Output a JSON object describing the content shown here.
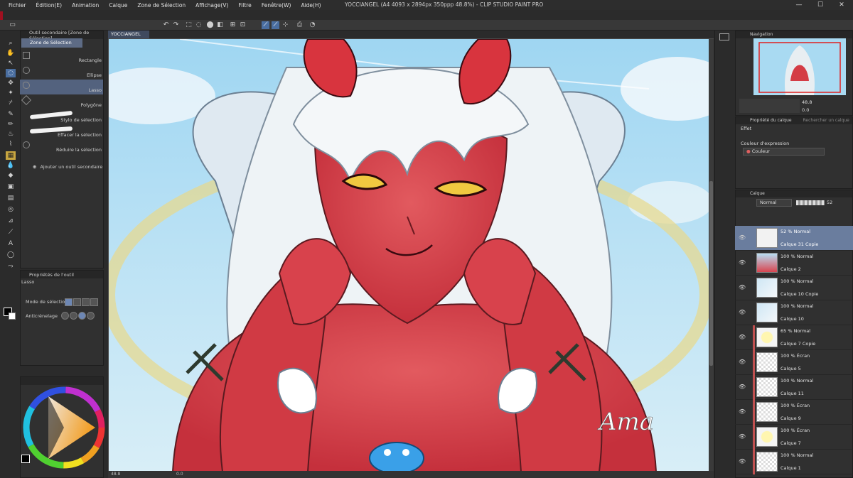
{
  "window": {
    "title": "YOCCIANGEL (A4 4093 x 2894px 350ppp 48.8%) - CLIP STUDIO PAINT PRO",
    "minimize": "—",
    "maximize": "☐",
    "close": "✕"
  },
  "menu": [
    "Fichier",
    "Édition(E)",
    "Animation",
    "Calque",
    "Zone de Sélection",
    "Affichage(V)",
    "Filtre",
    "Fenêtre(W)",
    "Aide(H)"
  ],
  "subtool": {
    "header": "Outil secondaire [Zone de Sélection]",
    "tab": "Zone de Sélection",
    "items": [
      {
        "label": "Rectangle",
        "selected": false
      },
      {
        "label": "Ellipse",
        "selected": false
      },
      {
        "label": "Lasso",
        "selected": true
      },
      {
        "label": "Polygône",
        "selected": false
      },
      {
        "label": "Stylo de sélection",
        "selected": false
      },
      {
        "label": "Effacer la sélection",
        "selected": false
      },
      {
        "label": "Réduire la sélection",
        "selected": false
      }
    ],
    "add": "Ajouter un outil secondaire"
  },
  "toolprops": {
    "header": "Propriétés de l'outil",
    "tool_name": "Lasso",
    "mode_label": "Mode de sélection",
    "aa_label": "Anticrénelage"
  },
  "canvas": {
    "tab": "YOCCIANGEL",
    "zoom": "48.8",
    "rotation": "0.0",
    "signature": "Ama"
  },
  "navigator": {
    "header": "Navigation",
    "zoom": "48.8",
    "angle": "0.0"
  },
  "layerprops": {
    "header": "Propriété du calque",
    "search": "Rechercher un calque",
    "effect": "Effet",
    "expr_color_label": "Couleur d'expression",
    "expr_color_value": "Couleur"
  },
  "layers_panel": {
    "header": "Calque",
    "blend": "Normal",
    "opacity": "52"
  },
  "layers": [
    {
      "mode": "52 % Normal",
      "name": "Calque 31 Copie",
      "selected": true,
      "thumb": "sketch"
    },
    {
      "mode": "100 % Normal",
      "name": "Calque 2",
      "selected": false,
      "thumb": "art"
    },
    {
      "mode": "100 % Normal",
      "name": "Calque 10 Copie",
      "selected": false,
      "thumb": "wing"
    },
    {
      "mode": "100 % Normal",
      "name": "Calque 10",
      "selected": false,
      "thumb": "wing"
    },
    {
      "mode": "65 % Normal",
      "name": "Calque 7 Copie",
      "selected": false,
      "thumb": "yellow"
    },
    {
      "mode": "100 % Écran",
      "name": "Calque 5",
      "selected": false,
      "thumb": "empty"
    },
    {
      "mode": "100 % Normal",
      "name": "Calque 11",
      "selected": false,
      "thumb": "empty"
    },
    {
      "mode": "100 % Écran",
      "name": "Calque 9",
      "selected": false,
      "thumb": "empty"
    },
    {
      "mode": "100 % Écran",
      "name": "Calque 7",
      "selected": false,
      "thumb": "yellow"
    },
    {
      "mode": "100 % Normal",
      "name": "Calque 1",
      "selected": false,
      "thumb": "empty"
    }
  ],
  "colors": {
    "accent": "#4a6ea0",
    "selected_row": "#6a7d9e",
    "skin": "#d9434a",
    "sky": "#aee0f5"
  }
}
